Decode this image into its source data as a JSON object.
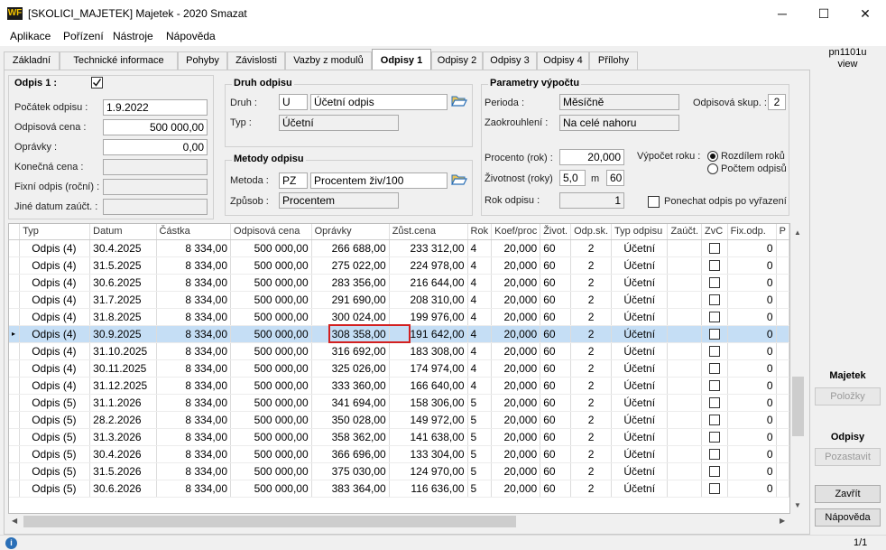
{
  "window": {
    "title": "[SKOLICI_MAJETEK] Majetek - 2020 Smazat",
    "logo": "WF",
    "minimize": "─",
    "maximize": "☐",
    "close": "✕"
  },
  "menu": [
    "Aplikace",
    "Pořízení",
    "Nástroje",
    "Nápověda"
  ],
  "tabs": [
    "Základní",
    "Technické informace",
    "Pohyby",
    "Závislosti",
    "Vazby z modulů",
    "Odpisy 1",
    "Odpisy 2",
    "Odpisy 3",
    "Odpisy 4",
    "Přílohy"
  ],
  "left": {
    "odpis_label": "Odpis 1 :",
    "odpis_checked": true,
    "pocatek_label": "Počátek odpisu :",
    "pocatek_value": "1.9.2022",
    "cena_label": "Odpisová cena :",
    "cena_value": "500 000,00",
    "opravky_label": "Oprávky :",
    "opravky_value": "0,00",
    "konecna_label": "Konečná cena :",
    "fixni_label": "Fixní odpis (roční) :",
    "jine_label": "Jiné datum zaúčt. :"
  },
  "druh": {
    "title": "Druh odpisu",
    "druh_label": "Druh :",
    "druh_code": "U",
    "druh_name": "Účetní odpis",
    "typ_label": "Typ :",
    "typ_value": "Účetní"
  },
  "metody": {
    "title": "Metody odpisu",
    "metoda_label": "Metoda :",
    "metoda_code": "PZ",
    "metoda_name": "Procentem živ/100",
    "zpusob_label": "Způsob :",
    "zpusob_value": "Procentem"
  },
  "params": {
    "title": "Parametry výpočtu",
    "perioda_label": "Perioda :",
    "perioda_value": "Měsíčně",
    "zaokr_label": "Zaokrouhlení :",
    "zaokr_value": "Na celé nahoru",
    "skup_label": "Odpisová skup. :",
    "skup_value": "2",
    "procento_label": "Procento (rok) :",
    "procento_value": "20,000",
    "zivotnost_label": "Životnost (roky)",
    "zivotnost_value": "5,0",
    "m_label": "m",
    "m_value": "60",
    "rok_label": "Rok odpisu :",
    "rok_value": "1",
    "vypocet_label": "Výpočet roku :",
    "radio1": "Rozdílem roků",
    "radio2": "Počtem odpisů",
    "ponechat_label": "Ponechat odpis po vyřazení"
  },
  "grid": {
    "columns": [
      "Typ",
      "Datum",
      "Částka",
      "Odpisová cena",
      "Oprávky",
      "Zůst.cena",
      "Rok",
      "Koef/proc",
      "Život.",
      "Odp.sk.",
      "Typ odpisu",
      "Zaúčt.",
      "ZvC",
      "Fix.odp.",
      "P"
    ],
    "rows": [
      [
        "Odpis (4)",
        "30.4.2025",
        "8 334,00",
        "500 000,00",
        "266 688,00",
        "233 312,00",
        "4",
        "20,000",
        "60",
        "2",
        "Účetní",
        "0"
      ],
      [
        "Odpis (4)",
        "31.5.2025",
        "8 334,00",
        "500 000,00",
        "275 022,00",
        "224 978,00",
        "4",
        "20,000",
        "60",
        "2",
        "Účetní",
        "0"
      ],
      [
        "Odpis (4)",
        "30.6.2025",
        "8 334,00",
        "500 000,00",
        "283 356,00",
        "216 644,00",
        "4",
        "20,000",
        "60",
        "2",
        "Účetní",
        "0"
      ],
      [
        "Odpis (4)",
        "31.7.2025",
        "8 334,00",
        "500 000,00",
        "291 690,00",
        "208 310,00",
        "4",
        "20,000",
        "60",
        "2",
        "Účetní",
        "0"
      ],
      [
        "Odpis (4)",
        "31.8.2025",
        "8 334,00",
        "500 000,00",
        "300 024,00",
        "199 976,00",
        "4",
        "20,000",
        "60",
        "2",
        "Účetní",
        "0"
      ],
      [
        "Odpis (4)",
        "30.9.2025",
        "8 334,00",
        "500 000,00",
        "308 358,00",
        "191 642,00",
        "4",
        "20,000",
        "60",
        "2",
        "Účetní",
        "0"
      ],
      [
        "Odpis (4)",
        "31.10.2025",
        "8 334,00",
        "500 000,00",
        "316 692,00",
        "183 308,00",
        "4",
        "20,000",
        "60",
        "2",
        "Účetní",
        "0"
      ],
      [
        "Odpis (4)",
        "30.11.2025",
        "8 334,00",
        "500 000,00",
        "325 026,00",
        "174 974,00",
        "4",
        "20,000",
        "60",
        "2",
        "Účetní",
        "0"
      ],
      [
        "Odpis (4)",
        "31.12.2025",
        "8 334,00",
        "500 000,00",
        "333 360,00",
        "166 640,00",
        "4",
        "20,000",
        "60",
        "2",
        "Účetní",
        "0"
      ],
      [
        "Odpis (5)",
        "31.1.2026",
        "8 334,00",
        "500 000,00",
        "341 694,00",
        "158 306,00",
        "5",
        "20,000",
        "60",
        "2",
        "Účetní",
        "0"
      ],
      [
        "Odpis (5)",
        "28.2.2026",
        "8 334,00",
        "500 000,00",
        "350 028,00",
        "149 972,00",
        "5",
        "20,000",
        "60",
        "2",
        "Účetní",
        "0"
      ],
      [
        "Odpis (5)",
        "31.3.2026",
        "8 334,00",
        "500 000,00",
        "358 362,00",
        "141 638,00",
        "5",
        "20,000",
        "60",
        "2",
        "Účetní",
        "0"
      ],
      [
        "Odpis (5)",
        "30.4.2026",
        "8 334,00",
        "500 000,00",
        "366 696,00",
        "133 304,00",
        "5",
        "20,000",
        "60",
        "2",
        "Účetní",
        "0"
      ],
      [
        "Odpis (5)",
        "31.5.2026",
        "8 334,00",
        "500 000,00",
        "375 030,00",
        "124 970,00",
        "5",
        "20,000",
        "60",
        "2",
        "Účetní",
        "0"
      ],
      [
        "Odpis (5)",
        "30.6.2026",
        "8 334,00",
        "500 000,00",
        "383 364,00",
        "116 636,00",
        "5",
        "20,000",
        "60",
        "2",
        "Účetní",
        "0"
      ]
    ],
    "selected_row": 5,
    "row_marker": "▸"
  },
  "side": {
    "code": "pn1101u",
    "mode": "view",
    "majetek_title": "Majetek",
    "polozky": "Položky",
    "odpisy_title": "Odpisy",
    "pozastavit": "Pozastavit",
    "zavrit": "Zavřít",
    "napoveda": "Nápověda"
  },
  "status": {
    "info": "i",
    "pager": "1/1"
  },
  "colors": {
    "selection": "#c5def5",
    "highlight": "#d32020",
    "logo_bg": "#1a1a1a",
    "logo_fg": "#f5c400"
  }
}
